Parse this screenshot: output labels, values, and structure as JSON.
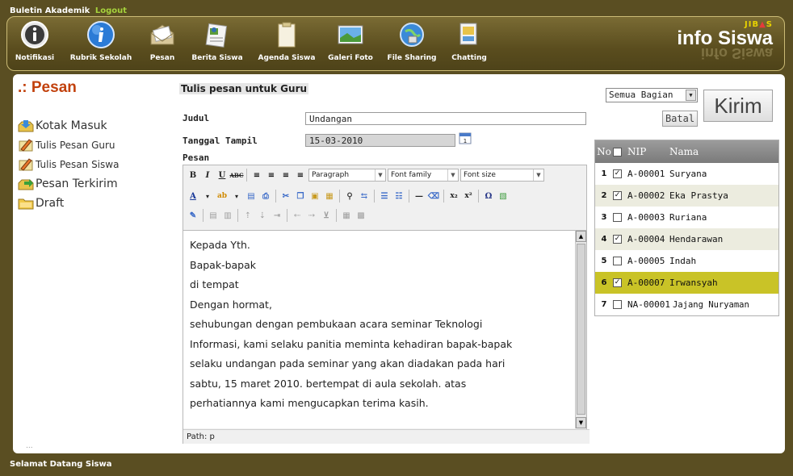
{
  "topbar": {
    "title": "Buletin Akademik",
    "logout": "Logout"
  },
  "nav": [
    {
      "label": "Notifikasi",
      "icon": "info-icon"
    },
    {
      "label": "Rubrik Sekolah",
      "icon": "info-globe-icon"
    },
    {
      "label": "Pesan",
      "icon": "envelope-icon"
    },
    {
      "label": "Berita Siswa",
      "icon": "news-icon"
    },
    {
      "label": "Agenda Siswa",
      "icon": "clipboard-icon"
    },
    {
      "label": "Galeri Foto",
      "icon": "photo-icon"
    },
    {
      "label": "File Sharing",
      "icon": "globe-icon"
    },
    {
      "label": "Chatting",
      "icon": "chat-icon"
    }
  ],
  "logo": {
    "prefix": "JIB",
    "suffix": "S",
    "main": "info Siswa",
    "reflection": "info Siswa"
  },
  "sidebar": {
    "title": ".: Pesan",
    "items": [
      {
        "label": "Kotak Masuk",
        "icon": "inbox-icon"
      },
      {
        "label": "Tulis Pesan Guru",
        "icon": "compose-icon"
      },
      {
        "label": "Tulis Pesan Siswa",
        "icon": "compose-icon"
      },
      {
        "label": "Pesan Terkirim",
        "icon": "sent-icon"
      },
      {
        "label": "Draft",
        "icon": "folder-icon"
      }
    ]
  },
  "form": {
    "heading": "Tulis pesan untuk Guru",
    "judul_label": "Judul",
    "judul_value": "Undangan",
    "tanggal_label": "Tanggal Tampil",
    "tanggal_value": "15-03-2010",
    "pesan_label": "Pesan"
  },
  "editor": {
    "format_select": "Paragraph",
    "font_family_select": "Font family",
    "font_size_select": "Font size",
    "content_lines": [
      "Kepada Yth.",
      "Bapak-bapak",
      "di tempat",
      "",
      "Dengan hormat,",
      "sehubungan dengan pembukaan acara seminar Teknologi",
      "Informasi, kami selaku panitia meminta kehadiran bapak-bapak",
      "selaku undangan pada seminar yang akan diadakan pada hari",
      "sabtu, 15 maret 2010. bertempat di aula sekolah. atas",
      "perhatiannya kami mengucapkan terima kasih."
    ],
    "path": "Path: p"
  },
  "recipients": {
    "department_select": "Semua Bagian",
    "send_button": "Kirim",
    "cancel_button": "Batal",
    "table_headers": {
      "no": "No",
      "nip": "NIP",
      "nama": "Nama"
    },
    "rows": [
      {
        "no": "1",
        "checked": true,
        "nip": "A-00001",
        "nama": "Suryana"
      },
      {
        "no": "2",
        "checked": true,
        "nip": "A-00002",
        "nama": "Eka Prastya"
      },
      {
        "no": "3",
        "checked": false,
        "nip": "A-00003",
        "nama": "Ruriana"
      },
      {
        "no": "4",
        "checked": true,
        "nip": "A-00004",
        "nama": "Hendarawan"
      },
      {
        "no": "5",
        "checked": false,
        "nip": "A-00005",
        "nama": "Indah"
      },
      {
        "no": "6",
        "checked": true,
        "nip": "A-00007",
        "nama": "Irwansyah"
      },
      {
        "no": "7",
        "checked": false,
        "nip": "NA-00001",
        "nama": "Jajang Nuryaman"
      }
    ],
    "selected_row": 6
  },
  "footer": {
    "text": "Selamat Datang Siswa",
    "dots": "..."
  },
  "colors": {
    "frame": "#5a4e22",
    "accent_title": "#c2410c",
    "selected_row": "#c9c327",
    "logout": "#a6d23c"
  }
}
